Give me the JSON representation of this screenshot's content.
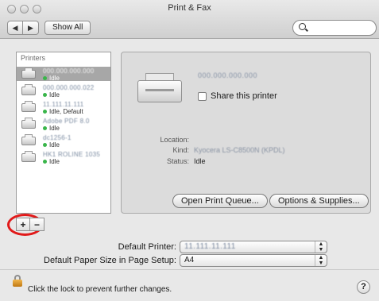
{
  "window": {
    "title": "Print & Fax"
  },
  "toolbar": {
    "back_icon": "◀",
    "forward_icon": "▶",
    "show_all_label": "Show All",
    "search_value": ""
  },
  "printers_list": {
    "header": "Printers",
    "items": [
      {
        "name": "000.000.000.000",
        "status": "Idle"
      },
      {
        "name": "000.000.000.022",
        "status": "Idle"
      },
      {
        "name": "11.111.11.111",
        "status": "Idle, Default"
      },
      {
        "name": "Adobe PDF 8.0",
        "status": "Idle"
      },
      {
        "name": "dc1256-1",
        "status": "Idle"
      },
      {
        "name": "HK1 ROLINE 1035",
        "status": "Idle"
      }
    ]
  },
  "list_controls": {
    "add_label": "+",
    "remove_label": "−"
  },
  "detail": {
    "printer_name": "000.000.000.000",
    "share_label": "Share this printer",
    "location_label": "Location:",
    "location_value": "",
    "kind_label": "Kind:",
    "kind_value": "Kyocera LS-C8500N (KPDL)",
    "status_label": "Status:",
    "status_value": "Idle",
    "open_queue_label": "Open Print Queue...",
    "options_label": "Options & Supplies..."
  },
  "defaults": {
    "default_printer_label": "Default Printer:",
    "default_printer_value": "11.111.11.111",
    "paper_size_label": "Default Paper Size in Page Setup:",
    "paper_size_value": "A4"
  },
  "footer": {
    "lock_text": "Click the lock to prevent further changes.",
    "help_label": "?"
  }
}
